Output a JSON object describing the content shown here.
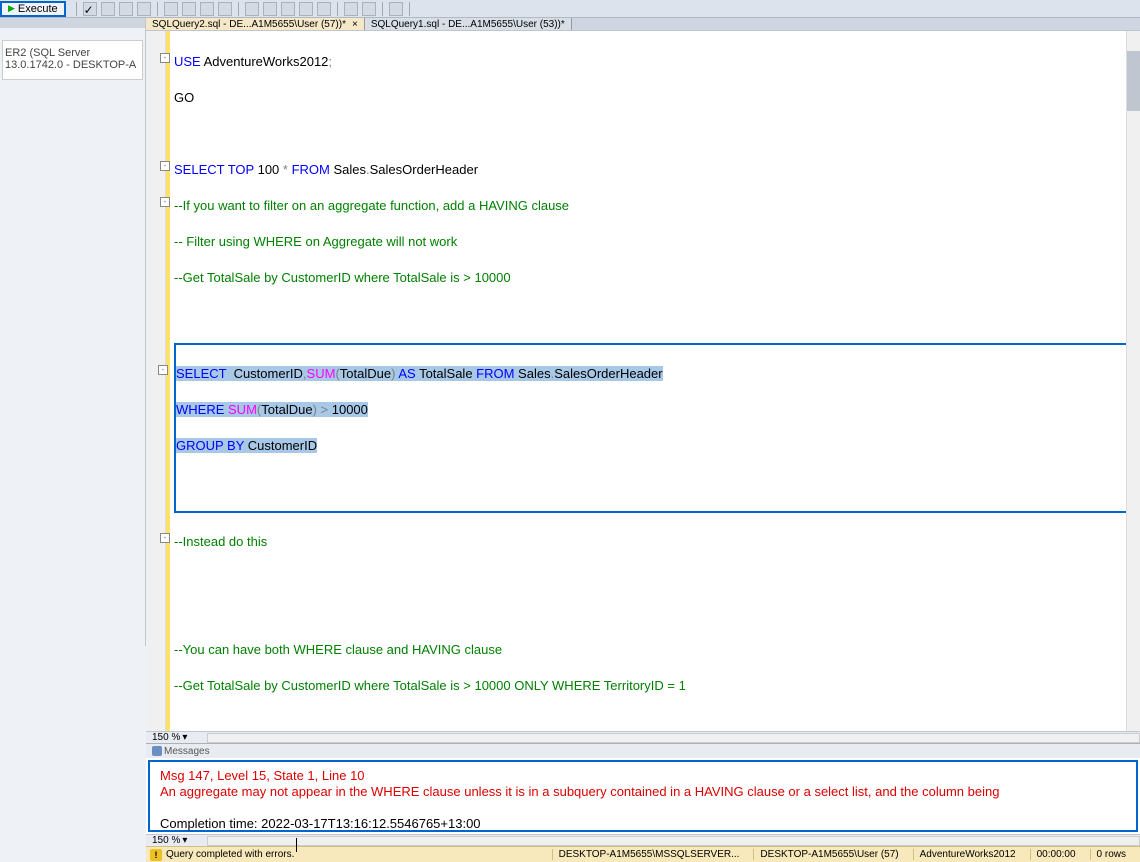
{
  "toolbar": {
    "execute_label": "Execute"
  },
  "sidebar": {
    "server_text": "ER2 (SQL Server 13.0.1742.0 - DESKTOP-A"
  },
  "tabs": [
    {
      "label": "SQLQuery2.sql - DE...A1M5655\\User (57))*",
      "active": true
    },
    {
      "label": "SQLQuery1.sql - DE...A1M5655\\User (53))*",
      "active": false
    }
  ],
  "code": {
    "line1_use": "USE",
    "line1_db": " AdventureWorks2012",
    "line1_semi": ";",
    "line2": "GO",
    "line3_select": "SELECT",
    "line3_top": " TOP",
    "line3_num": " 100",
    "line3_star": " * ",
    "line3_from": "FROM",
    "line3_schema": " Sales",
    "line3_dot": ".",
    "line3_tbl": "SalesOrderHeader",
    "line4": "--If you want to filter on an aggregate function, add a HAVING clause",
    "line5": "-- Filter using WHERE on Aggregate will not work",
    "line6": "--Get TotalSale by CustomerID where TotalSale is > 10000",
    "sel_l1_select": "SELECT",
    "sel_l1_sp": "  CustomerID",
    "sel_l1_comma": ",",
    "sel_l1_sum": "SUM",
    "sel_l1_p1": "(",
    "sel_l1_td": "TotalDue",
    "sel_l1_p2": ")",
    "sel_l1_as": " AS",
    "sel_l1_ts": " TotalSale ",
    "sel_l1_from": "FROM",
    "sel_l1_schema": " Sales",
    "sel_l1_dot": ".",
    "sel_l1_tbl": "SalesOrderHeader",
    "sel_l2_where": "WHERE",
    "sel_l2_sp": " ",
    "sel_l2_sum": "SUM",
    "sel_l2_p1": "(",
    "sel_l2_td": "TotalDue",
    "sel_l2_p2": ")",
    "sel_l2_gt": " > ",
    "sel_l2_num": "10000",
    "sel_l3_group": "GROUP",
    "sel_l3_by": " BY",
    "sel_l3_col": " CustomerID",
    "line_instead": "--Instead do this",
    "line_both": "--You can have both WHERE clause and HAVING clause",
    "line_terr": "--Get TotalSale by CustomerID where TotalSale is > 10000 ONLY WHERE TerritoryID = 1"
  },
  "editor_zoom": "150 %",
  "messages_tab_label": "Messages",
  "messages": {
    "err_line": "Msg 147, Level 15, State 1, Line 10",
    "err_body": "An aggregate may not appear in the WHERE clause unless it is in a subquery contained in a HAVING clause or a select list, and the column being",
    "completion": "Completion time: 2022-03-17T13:16:12.5546765+13:00"
  },
  "results_zoom": "150 %",
  "status": {
    "left": "Query completed with errors.",
    "server": "DESKTOP-A1M5655\\MSSQLSERVER...",
    "user": "DESKTOP-A1M5655\\User (57)",
    "db": "AdventureWorks2012",
    "time": "00:00:00",
    "rows": "0 rows"
  }
}
